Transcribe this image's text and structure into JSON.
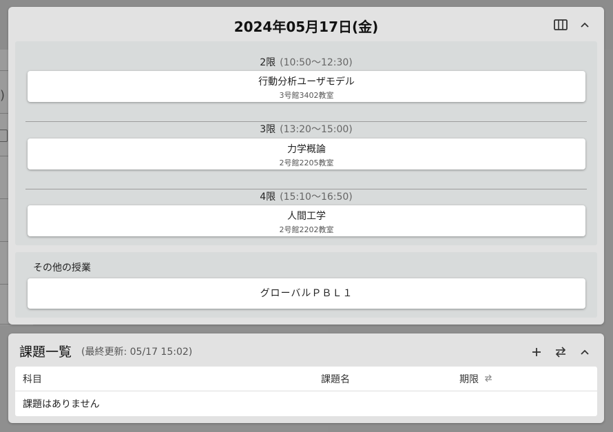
{
  "schedule": {
    "date": "2024年05月17日(金)",
    "columns_icon": "columns-icon",
    "collapse_icon": "chevron-up-icon",
    "periods": [
      {
        "num": "2限",
        "time": "(10:50〜12:30)",
        "class_name": "行動分析ユーザモデル",
        "room": "3号館3402教室"
      },
      {
        "num": "3限",
        "time": "(13:20〜15:00)",
        "class_name": "力学概論",
        "room": "2号館2205教室"
      },
      {
        "num": "4限",
        "time": "(15:10〜16:50)",
        "class_name": "人間工学",
        "room": "2号館2202教室"
      }
    ],
    "other_title": "その他の授業",
    "other_classes": [
      "グローバルＰＢＬ１"
    ]
  },
  "tasks": {
    "title": "課題一覧",
    "updated": "(最終更新: 05/17 15:02)",
    "add_icon": "plus-icon",
    "sync_icon": "swap-icon",
    "collapse_icon": "chevron-up-icon",
    "columns": {
      "subject": "科目",
      "task_name": "課題名",
      "deadline": "期限"
    },
    "empty_message": "課題はありません"
  },
  "background": {
    "left_glyph": ")"
  },
  "colors": {
    "overlay": "#8f8f8f",
    "card": "#e2e2e2",
    "panel": "#d8dbdb",
    "item": "#ffffff"
  }
}
